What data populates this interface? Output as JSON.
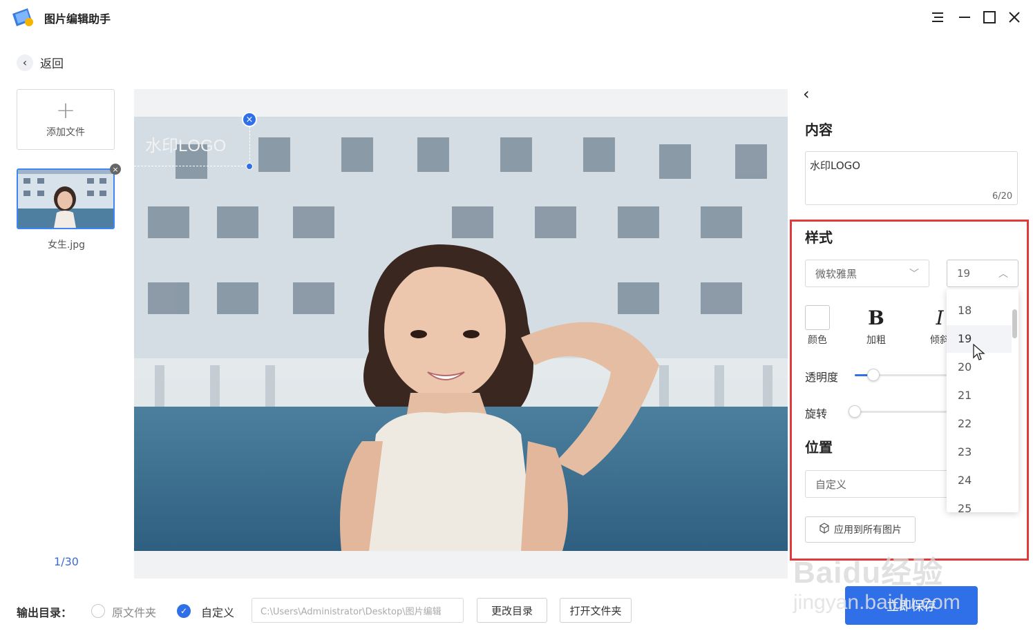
{
  "app": {
    "title": "图片编辑助手"
  },
  "nav": {
    "back_label": "返回"
  },
  "files": {
    "add_label": "添加文件",
    "items": [
      {
        "name": "女生.jpg"
      }
    ],
    "counter": "1/30"
  },
  "canvas": {
    "watermark_text": "水印LOGO"
  },
  "panel": {
    "content": {
      "title": "内容",
      "value": "水印LOGO",
      "count": "6/20"
    },
    "style": {
      "title": "样式",
      "font": "微软雅黑",
      "size": "19",
      "color_label": "颜色",
      "bold_label": "加粗",
      "italic_label": "倾斜",
      "opacity_label": "透明度",
      "rotate_label": "旋转",
      "opacity_value": 0.2,
      "rotate_value": 0.0
    },
    "size_options": [
      "18",
      "19",
      "20",
      "21",
      "22",
      "23",
      "24",
      "25"
    ],
    "position": {
      "title": "位置",
      "value": "自定义"
    },
    "apply_all_label": "应用到所有图片"
  },
  "output": {
    "label": "输出目录：",
    "option_original": "原文件夹",
    "option_custom": "自定义",
    "selected": "custom",
    "path": "C:\\Users\\Administrator\\Desktop\\图片编辑",
    "change_dir_label": "更改目录",
    "open_folder_label": "打开文件夹",
    "primary_label": "立即保存"
  },
  "overlay": {
    "site_watermark": "Baidu经验",
    "site_url": "jingyan.baidu.com"
  },
  "colors": {
    "accent": "#2f6fe8",
    "highlight_frame": "#e03a3a"
  }
}
